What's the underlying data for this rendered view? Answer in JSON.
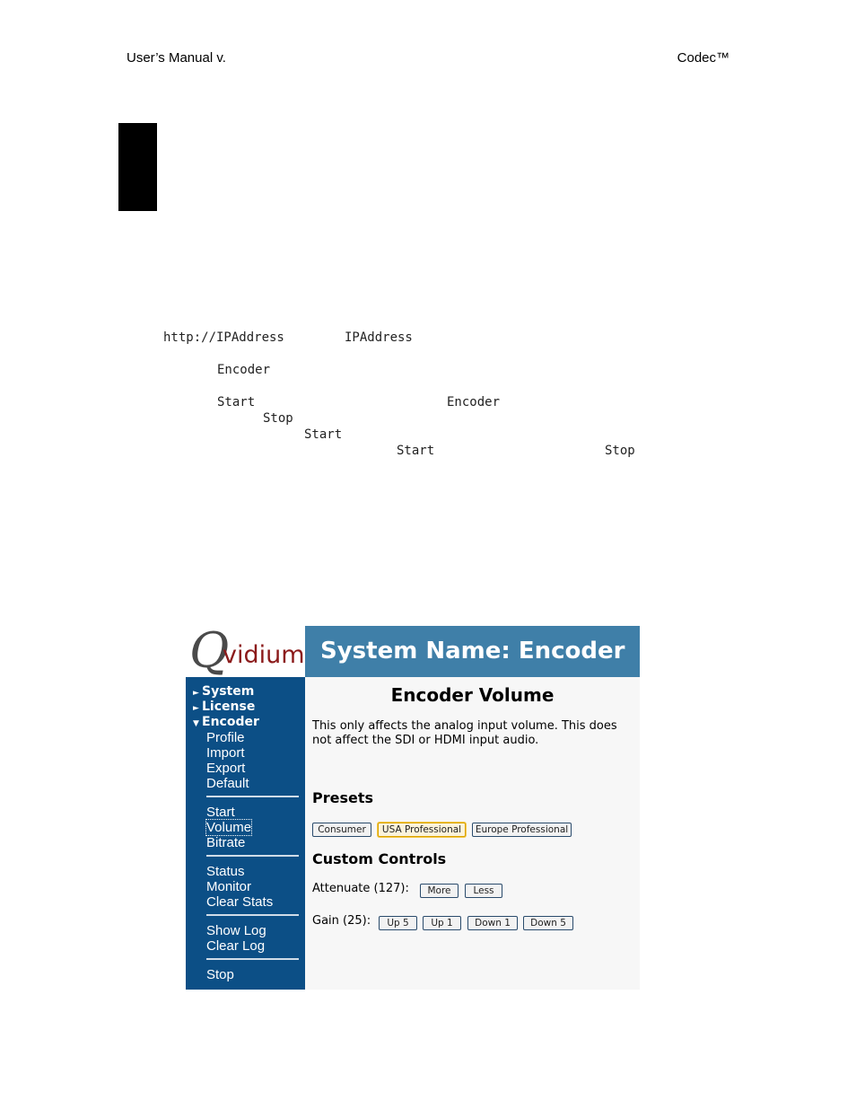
{
  "header": {
    "left": "User’s Manual v.",
    "right": "Codec™"
  },
  "body_text": {
    "line1_a": "http://IPAddress",
    "line1_b": "IPAddress",
    "line2": "Encoder",
    "line3_a": "Start",
    "line3_b": "Encoder",
    "line4": "Stop",
    "line5": "Start",
    "line6_a": "Start",
    "line6_b": "Stop"
  },
  "screenshot": {
    "logo": {
      "q": "Q",
      "rest": "vidium"
    },
    "title": "System Name: Encoder",
    "nav": {
      "cats": [
        "System",
        "License",
        "Encoder"
      ],
      "group1": [
        "Profile",
        "Import",
        "Export",
        "Default"
      ],
      "group2": [
        "Start",
        "Volume",
        "Bitrate"
      ],
      "group3": [
        "Status",
        "Monitor",
        "Clear Stats"
      ],
      "group4": [
        "Show Log",
        "Clear Log"
      ],
      "group5": [
        "Stop"
      ],
      "active": "Volume"
    },
    "content": {
      "title": "Encoder Volume",
      "description": "This only affects the analog input volume. This does not affect the SDI or HDMI input audio.",
      "presets_heading": "Presets",
      "presets": [
        "Consumer",
        "USA Professional",
        "Europe Professional"
      ],
      "custom_heading": "Custom Controls",
      "attenuate_label": "Attenuate (127):",
      "attenuate_buttons": [
        "More",
        "Less"
      ],
      "gain_label": "Gain (25):",
      "gain_buttons": [
        "Up 5",
        "Up 1",
        "Down 1",
        "Down 5"
      ]
    }
  }
}
